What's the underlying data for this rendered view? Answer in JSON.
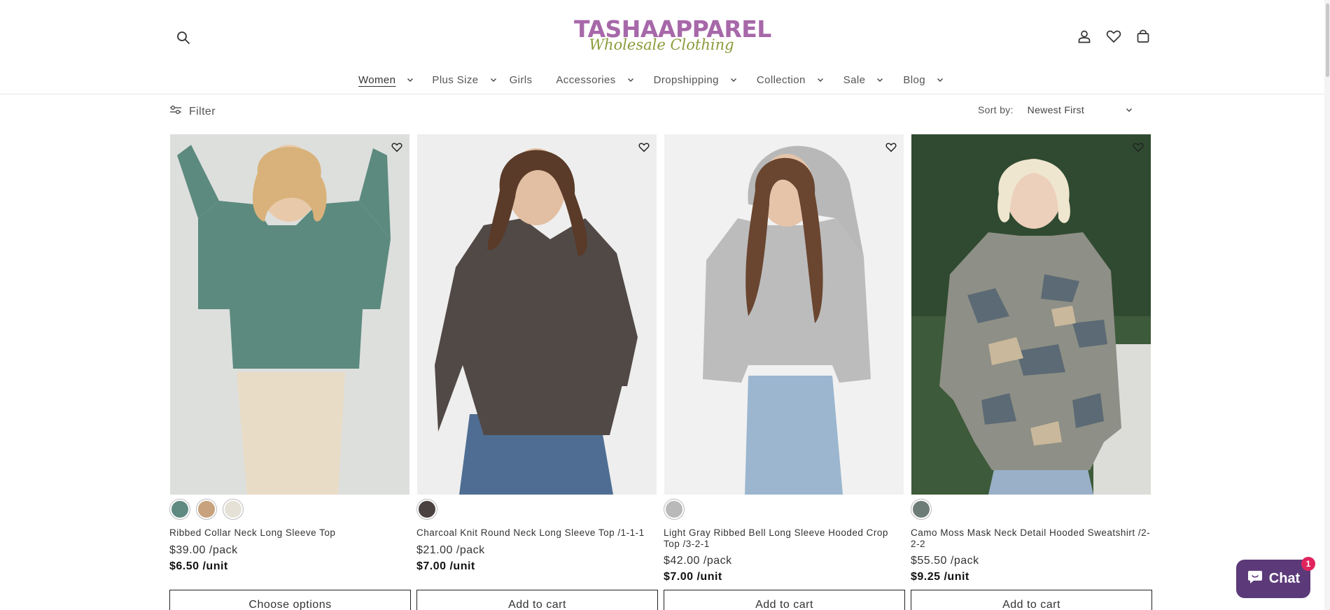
{
  "brand": {
    "name": "TASHAAPPAREL",
    "tagline": "Wholesale Clothing",
    "primary_color": "#a768a9",
    "tagline_color": "#8c9b3c"
  },
  "header": {
    "icons": [
      "search-icon",
      "account-icon",
      "wishlist-icon",
      "cart-icon"
    ]
  },
  "nav": {
    "items": [
      {
        "label": "Women",
        "has_dropdown": true,
        "active": true
      },
      {
        "label": "Plus Size",
        "has_dropdown": true
      },
      {
        "label": "Girls",
        "has_dropdown": false
      },
      {
        "label": "Accessories",
        "has_dropdown": true
      },
      {
        "label": "Dropshipping",
        "has_dropdown": true
      },
      {
        "label": "Collection",
        "has_dropdown": true
      },
      {
        "label": "Sale",
        "has_dropdown": true
      },
      {
        "label": "Blog",
        "has_dropdown": true
      }
    ]
  },
  "filter": {
    "label": "Filter"
  },
  "sort": {
    "label": "Sort by:",
    "selected": "Newest First"
  },
  "products": [
    {
      "title": "Ribbed Collar Neck Long Sleeve Top",
      "price_pack": "$39.00 /pack",
      "price_unit": "$6.50 /unit",
      "button": "Choose options",
      "swatches": [
        "#5f8a82",
        "#c7a27c",
        "#e6e1d6"
      ]
    },
    {
      "title": "Charcoal Knit Round Neck Long Sleeve Top /1-1-1",
      "price_pack": "$21.00 /pack",
      "price_unit": "$7.00 /unit",
      "button": "Add to cart",
      "swatches": [
        "#4a4240"
      ]
    },
    {
      "title": "Light Gray Ribbed Bell Long Sleeve Hooded Crop Top /3-2-1",
      "price_pack": "$42.00 /pack",
      "price_unit": "$7.00 /unit",
      "button": "Add to cart",
      "swatches": [
        "#b9b9b9"
      ]
    },
    {
      "title": "Camo Moss Mask Neck Detail Hooded Sweatshirt /2-2-2",
      "price_pack": "$55.50 /pack",
      "price_unit": "$9.25 /unit",
      "button": "Add to cart",
      "swatches": [
        "#6e7c77"
      ]
    }
  ],
  "chat": {
    "label": "Chat",
    "badge": "1",
    "color": "#5c3a79"
  }
}
